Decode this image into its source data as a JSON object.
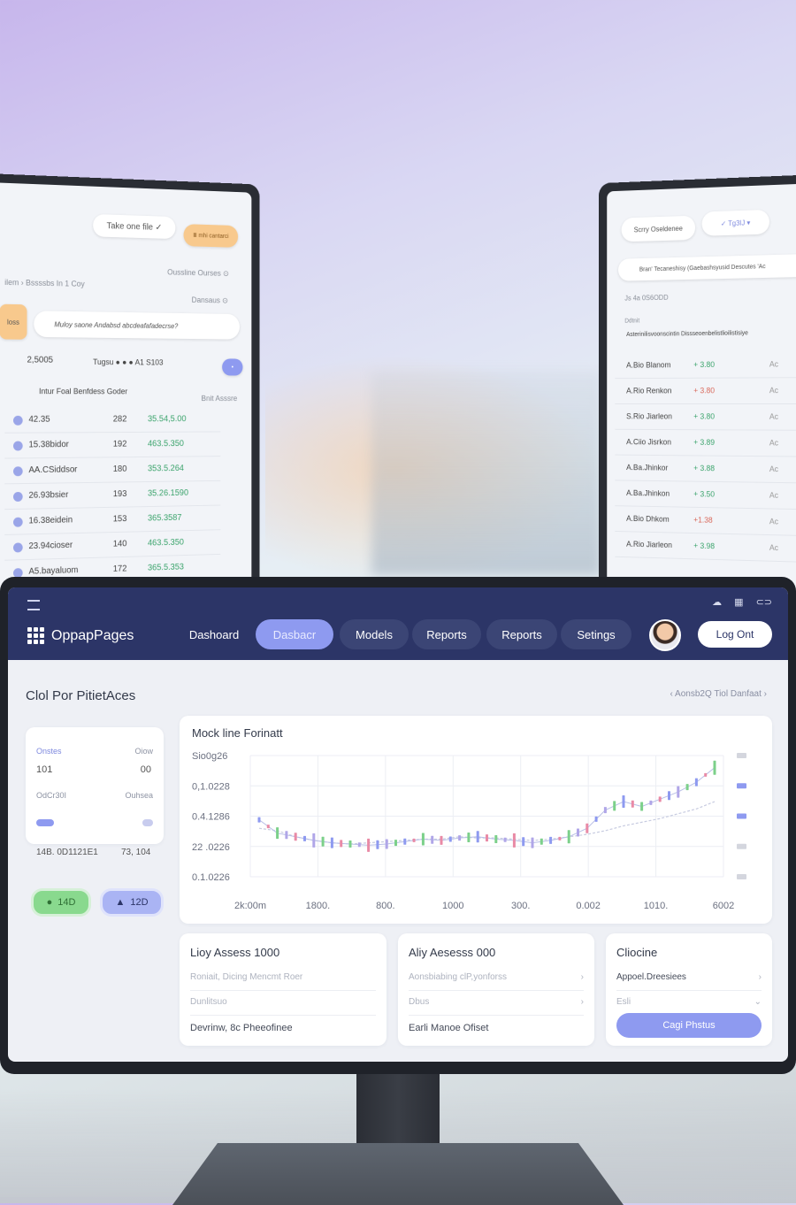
{
  "left_screen": {
    "pill_1": "Take one file  ✓",
    "pill_2": "Ⅲ mhi cantarci",
    "option_1": "Oussline  Ourses ⊙",
    "option_2": "Dansaus  ⊙",
    "breadcrumb": "ilem  ›  Bssssbs In 1 Coy",
    "tab": "loss",
    "message": "Muloy saone Andabsd abcdeafafadecrse?",
    "amount": "2,5005",
    "tags": "Tugsu  ● ● ●  A1 S103",
    "header_left": "Intur Foal Benfdess Goder",
    "header_right": "Bnit Asssre",
    "rows": [
      {
        "name": "42.35",
        "qty": "282",
        "val": "35.54,5.00"
      },
      {
        "name": "15.38bidor",
        "qty": "192",
        "val": "463.5.350"
      },
      {
        "name": "AA.CSiddsor",
        "qty": "180",
        "val": "353.5.264"
      },
      {
        "name": "26.93bsier",
        "qty": "193",
        "val": "35.26.1590"
      },
      {
        "name": "16.38eidein",
        "qty": "153",
        "val": "365.3587"
      },
      {
        "name": "23.94cioser",
        "qty": "140",
        "val": "463.5.350"
      },
      {
        "name": "A5.bayaluom",
        "qty": "172",
        "val": "365.5.353"
      }
    ]
  },
  "right_screen": {
    "pill_1": "Scrry Oseldenee",
    "pill_2": "✓  Tg3IJ  ▾",
    "message": "Bran' Tecaneshisy (Gaebashsyusid Descutes 'Ac",
    "date": "Js 4a 0S6ODD",
    "label": "Ddtnit",
    "subheader": "Asterinilisvoonscintin Dissseoenbelistlioilistisiye",
    "rows": [
      {
        "name": "A.Bio Blanom",
        "val": "+ 3.80",
        "end": "Ac"
      },
      {
        "name": "A.Rio Renkon",
        "val": "+ 3.80",
        "end": "Ac"
      },
      {
        "name": "S.Rio Jiarleon",
        "val": "+ 3.80",
        "end": "Ac"
      },
      {
        "name": "A.Ciio Jisrkon",
        "val": "+ 3.89",
        "end": "Ac"
      },
      {
        "name": "A.Ba.Jhinkor",
        "val": "+ 3.88",
        "end": "Ac"
      },
      {
        "name": "A.Ba.Jhinkon",
        "val": "+ 3.50",
        "end": "Ac"
      },
      {
        "name": "A.Bio Dhkom",
        "val": "+1.38",
        "end": "Ac"
      },
      {
        "name": "A.Rio Jiarleon",
        "val": "+ 3.98",
        "end": "Ac"
      }
    ]
  },
  "app": {
    "brand": "OppapPages",
    "nav": [
      "Dashoard",
      "Dasbacr",
      "Models",
      "Reports",
      "Reports",
      "Setings"
    ],
    "active_nav_index": 1,
    "logout": "Log Ont",
    "page_title": "Clol Por PitietAces",
    "breadcrumb": "‹  Aonsb2Q Tiol Danfaat  ›"
  },
  "stats": {
    "label_a": "Onstes",
    "label_b": "Oiow",
    "val_a": "101",
    "val_b": "00",
    "label_c": "OdCr30I",
    "label_d": "Ouhsea",
    "foot_a": "14B. 0D1121E1",
    "foot_b": "73, 104",
    "chip_green": "14D",
    "chip_blue": "12D"
  },
  "chart": {
    "title": "Mock line Forinatt",
    "yticks": [
      "Sio0g26",
      "0,1.0228",
      "0.4.1286",
      "22 .0226",
      "0.1.0226"
    ],
    "xticks": [
      "2k:00m",
      "1800.",
      "800.",
      "1000",
      "300.",
      "0.002",
      "1010.",
      "6002"
    ]
  },
  "chart_data": {
    "type": "line",
    "title": "Mock line Forinatt",
    "x_labels": [
      "2k:00m",
      "1800.",
      "800.",
      "1000",
      "300.",
      "0.002",
      "1010.",
      "6002"
    ],
    "y_labels": [
      "Sio0g26",
      "0,1.0228",
      "0.4.1286",
      "22 .0226",
      "0.1.0226"
    ],
    "series": [
      {
        "values": [
          0.47,
          0.36,
          0.33,
          0.3,
          0.28,
          0.27,
          0.26,
          0.27,
          0.29,
          0.31,
          0.3,
          0.32,
          0.33,
          0.31,
          0.3,
          0.28,
          0.3,
          0.33,
          0.4,
          0.55,
          0.62,
          0.58,
          0.64,
          0.7,
          0.78,
          0.9
        ]
      },
      {
        "values": [
          0.4,
          0.38,
          0.33,
          0.3,
          0.28,
          0.27,
          0.28,
          0.29,
          0.3,
          0.31,
          0.31,
          0.33,
          0.32,
          0.32,
          0.31,
          0.3,
          0.31,
          0.33,
          0.35,
          0.38,
          0.42,
          0.45,
          0.48,
          0.52,
          0.56,
          0.62
        ]
      }
    ],
    "grid": true
  },
  "bottom": {
    "card1": {
      "title": "Lioy Assess 1000",
      "row1": "Roniait, Dicing Mencmt Roer",
      "row2": "Dunlitsuo",
      "foot": "Devrinw, 8c Pheeofinee"
    },
    "card2": {
      "title": "Aliy Aesesss 000",
      "row1": "Aonsbiabing clP,yonforss",
      "row2": "Dbus",
      "foot": "Earli Manoe Ofiset"
    },
    "card3": {
      "title": "Cliocine",
      "row1": "Appoel.Dreesiees",
      "row2": "Esli",
      "button": "Cagi Phstus"
    }
  }
}
